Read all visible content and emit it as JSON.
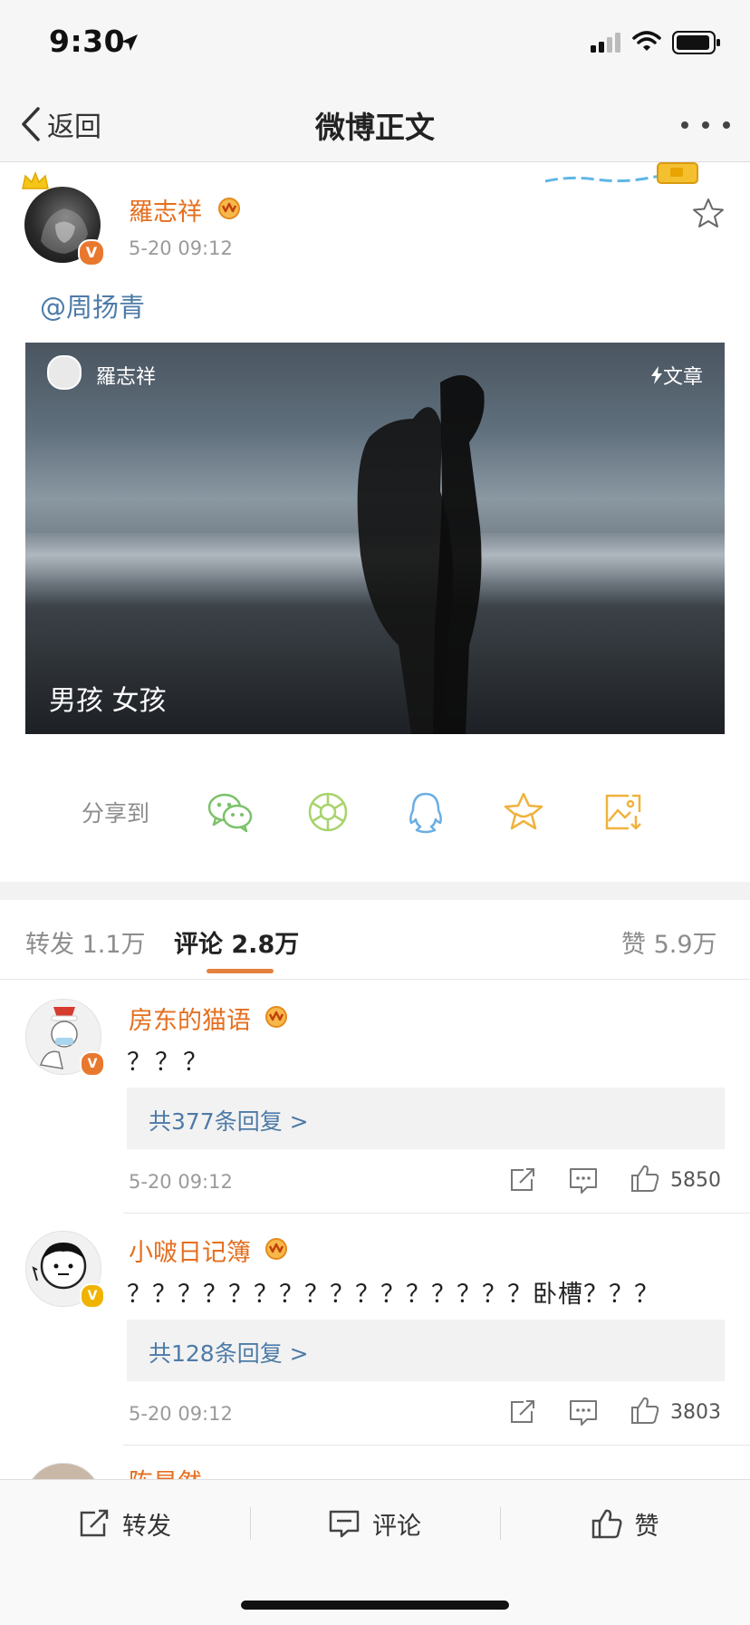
{
  "status_bar": {
    "time": "9:30"
  },
  "nav": {
    "back_label": "返回",
    "title": "微博正文"
  },
  "post": {
    "author": "羅志祥",
    "time": "5-20 09:12",
    "mention": "@周扬青",
    "card": {
      "author": "羅志祥",
      "tag": "文章",
      "title": "男孩 女孩"
    }
  },
  "share": {
    "label": "分享到",
    "targets": [
      "wechat-icon",
      "moments-icon",
      "qq-icon",
      "favorite-star-icon",
      "save-image-icon"
    ]
  },
  "tabs": {
    "repost": "转发 1.1万",
    "comment": "评论 2.8万",
    "like": "赞 5.9万"
  },
  "comments": [
    {
      "name": "房东的猫语",
      "text": "？？？",
      "replies": "共377条回复 >",
      "time": "5-20 09:12",
      "likes": "5850",
      "badge_color": "#e9782f"
    },
    {
      "name": "小啵日记簿",
      "text": "？？？？？？？？？？？？？？？？卧槽？？？",
      "replies": "共128条回复 >",
      "time": "5-20 09:12",
      "likes": "3803",
      "badge_color": "#f0b400"
    },
    {
      "name": "陈昊然"
    }
  ],
  "bottom_bar": {
    "repost": "转发",
    "comment": "评论",
    "like": "赞"
  },
  "colors": {
    "accent_orange": "#e56f1f",
    "link_blue": "#4d7ba8",
    "tab_indicator": "#e5813d"
  }
}
